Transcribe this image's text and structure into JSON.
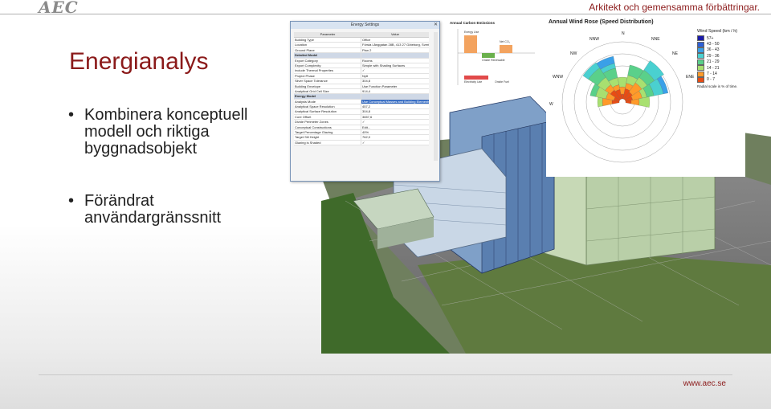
{
  "header": {
    "logo": "AEC",
    "tagline": "Arkitekt och gemensamma förbättringar."
  },
  "slide": {
    "title": "Energianalys",
    "bullets": [
      "Kombinera konceptuell modell och riktiga byggnadsobjekt",
      "Förändrat användargränssnitt"
    ]
  },
  "footer": {
    "url": "www.aec.se"
  },
  "dialog": {
    "title": "Energy Settings",
    "col_parameter": "Parameter",
    "col_value": "Value",
    "rows": [
      {
        "k": "Building Type",
        "v": "Office"
      },
      {
        "k": "Location",
        "v": "Första Långgatan 28B, 413 27 Göteborg, Sverige"
      },
      {
        "k": "Ground Plane",
        "v": "Plan 2"
      },
      {
        "k": "Detailed Model",
        "v": "",
        "section": true
      },
      {
        "k": "Export Category",
        "v": "Rooms"
      },
      {
        "k": "Export Complexity",
        "v": "Simple with Shading Surfaces"
      },
      {
        "k": "Include Thermal Properties",
        "v": "✓"
      },
      {
        "k": "Project Phase",
        "v": "Nytt"
      },
      {
        "k": "Sliver Space Tolerance",
        "v": "304,8"
      },
      {
        "k": "Building Envelope",
        "v": "Use Function Parameter"
      },
      {
        "k": "Analytical Grid Cell Size",
        "v": "914,4"
      },
      {
        "k": "Energy Model",
        "v": "",
        "section": true
      },
      {
        "k": "Analysis Mode",
        "v": "Use Conceptual Masses and Building Elements",
        "hl": true
      },
      {
        "k": "Analytical Space Resolution",
        "v": "457,2"
      },
      {
        "k": "Analytical Surface Resolution",
        "v": "304,8"
      },
      {
        "k": "Core Offset",
        "v": "3657,6"
      },
      {
        "k": "Divide Perimeter Zones",
        "v": "✓"
      },
      {
        "k": "Conceptual Constructions",
        "v": "Edit..."
      },
      {
        "k": "Target Percentage Glazing",
        "v": "40%"
      },
      {
        "k": "Target Sill Height",
        "v": "762,0"
      },
      {
        "k": "Glazing is Shaded",
        "v": "✓"
      }
    ]
  },
  "carbon": {
    "title": "Annual Carbon Emissions",
    "labels": [
      "Energy Use",
      "Onsite Renewable",
      "Net CO₂",
      "Electricity Use",
      "Onsite Fuel"
    ]
  },
  "windrose": {
    "title": "Annual Wind Rose (Speed Distribution)",
    "directions": [
      "N",
      "NNE",
      "NE",
      "ENE",
      "NW",
      "NNW",
      "WNW",
      "W"
    ],
    "legend_title": "Wind Speed (km / h)",
    "legend": [
      {
        "label": "57+",
        "color": "#1a1aa8"
      },
      {
        "label": "43 - 50",
        "color": "#2c5fd8"
      },
      {
        "label": "36 - 43",
        "color": "#3aa0e8"
      },
      {
        "label": "29 - 36",
        "color": "#4ad0d0"
      },
      {
        "label": "21 - 29",
        "color": "#5ad08a"
      },
      {
        "label": "14 - 21",
        "color": "#a8e070"
      },
      {
        "label": "7 - 14",
        "color": "#ff9a2a"
      },
      {
        "label": "0 - 7",
        "color": "#e84c14"
      }
    ],
    "note": "Radial scale is % of time."
  }
}
